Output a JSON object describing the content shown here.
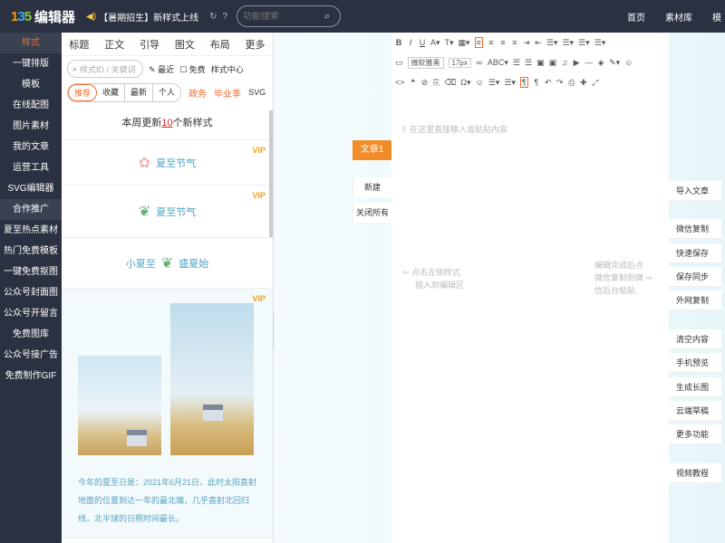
{
  "header": {
    "logo_mark": "135",
    "logo_text": "编辑器",
    "notice": "【暑期招生】新样式上线",
    "search_placeholder": "功能搜索",
    "nav": [
      "首页",
      "素材库",
      "模"
    ]
  },
  "sidebar": {
    "items": [
      "样式",
      "一键排版",
      "模板",
      "在线配图",
      "图片素材",
      "我的文章",
      "运营工具",
      "SVG编辑器",
      "合作推广",
      "夏至热点素材",
      "热门免费模板",
      "一键免费抠图",
      "公众号封面图",
      "公众号开留言",
      "免费图库",
      "公众号接广告",
      "免费制作GIF"
    ]
  },
  "panel": {
    "tabs": [
      "标题",
      "正文",
      "引导",
      "图文",
      "布局",
      "更多"
    ],
    "search_placeholder": "样式ID / 关键词",
    "filters": [
      "最近",
      "免费",
      "样式中心"
    ],
    "chips": [
      "推荐",
      "收藏",
      "最新",
      "个人"
    ],
    "tags": [
      "政务",
      "毕业季",
      "SVG"
    ],
    "updated_prefix": "本周更新",
    "updated_num": "10",
    "updated_suffix": "个新样式",
    "card1": "夏至节气",
    "card2": "夏至节气",
    "card3_left": "小夏至",
    "card3_right": "盛夏始",
    "vip": "VIP",
    "big_text": "今年的夏至日是：2021年6月21日，此时太阳直射地面的位置到达一年的最北端，几乎直射北回归线，北半球的日照时间最长。"
  },
  "editor": {
    "font_family": "微软雅黑",
    "font_size": "17px",
    "placeholder": "在这里直接输入或粘贴内容",
    "hint_left_1": "点击左侧样式",
    "hint_left_2": "插入到编辑区",
    "hint_right_1": "编辑完成后点",
    "hint_right_2": "微信复制到微",
    "hint_right_3": "信后台粘贴"
  },
  "articles": {
    "tab1": "文章1",
    "new": "新建",
    "close_all": "关闭所有"
  },
  "right_buttons": [
    "导入文章",
    "微信复制",
    "快速保存",
    "保存同步",
    "外网复制",
    "清空内容",
    "手机预览",
    "生成长图",
    "云端草稿",
    "更多功能",
    "视频教程"
  ]
}
